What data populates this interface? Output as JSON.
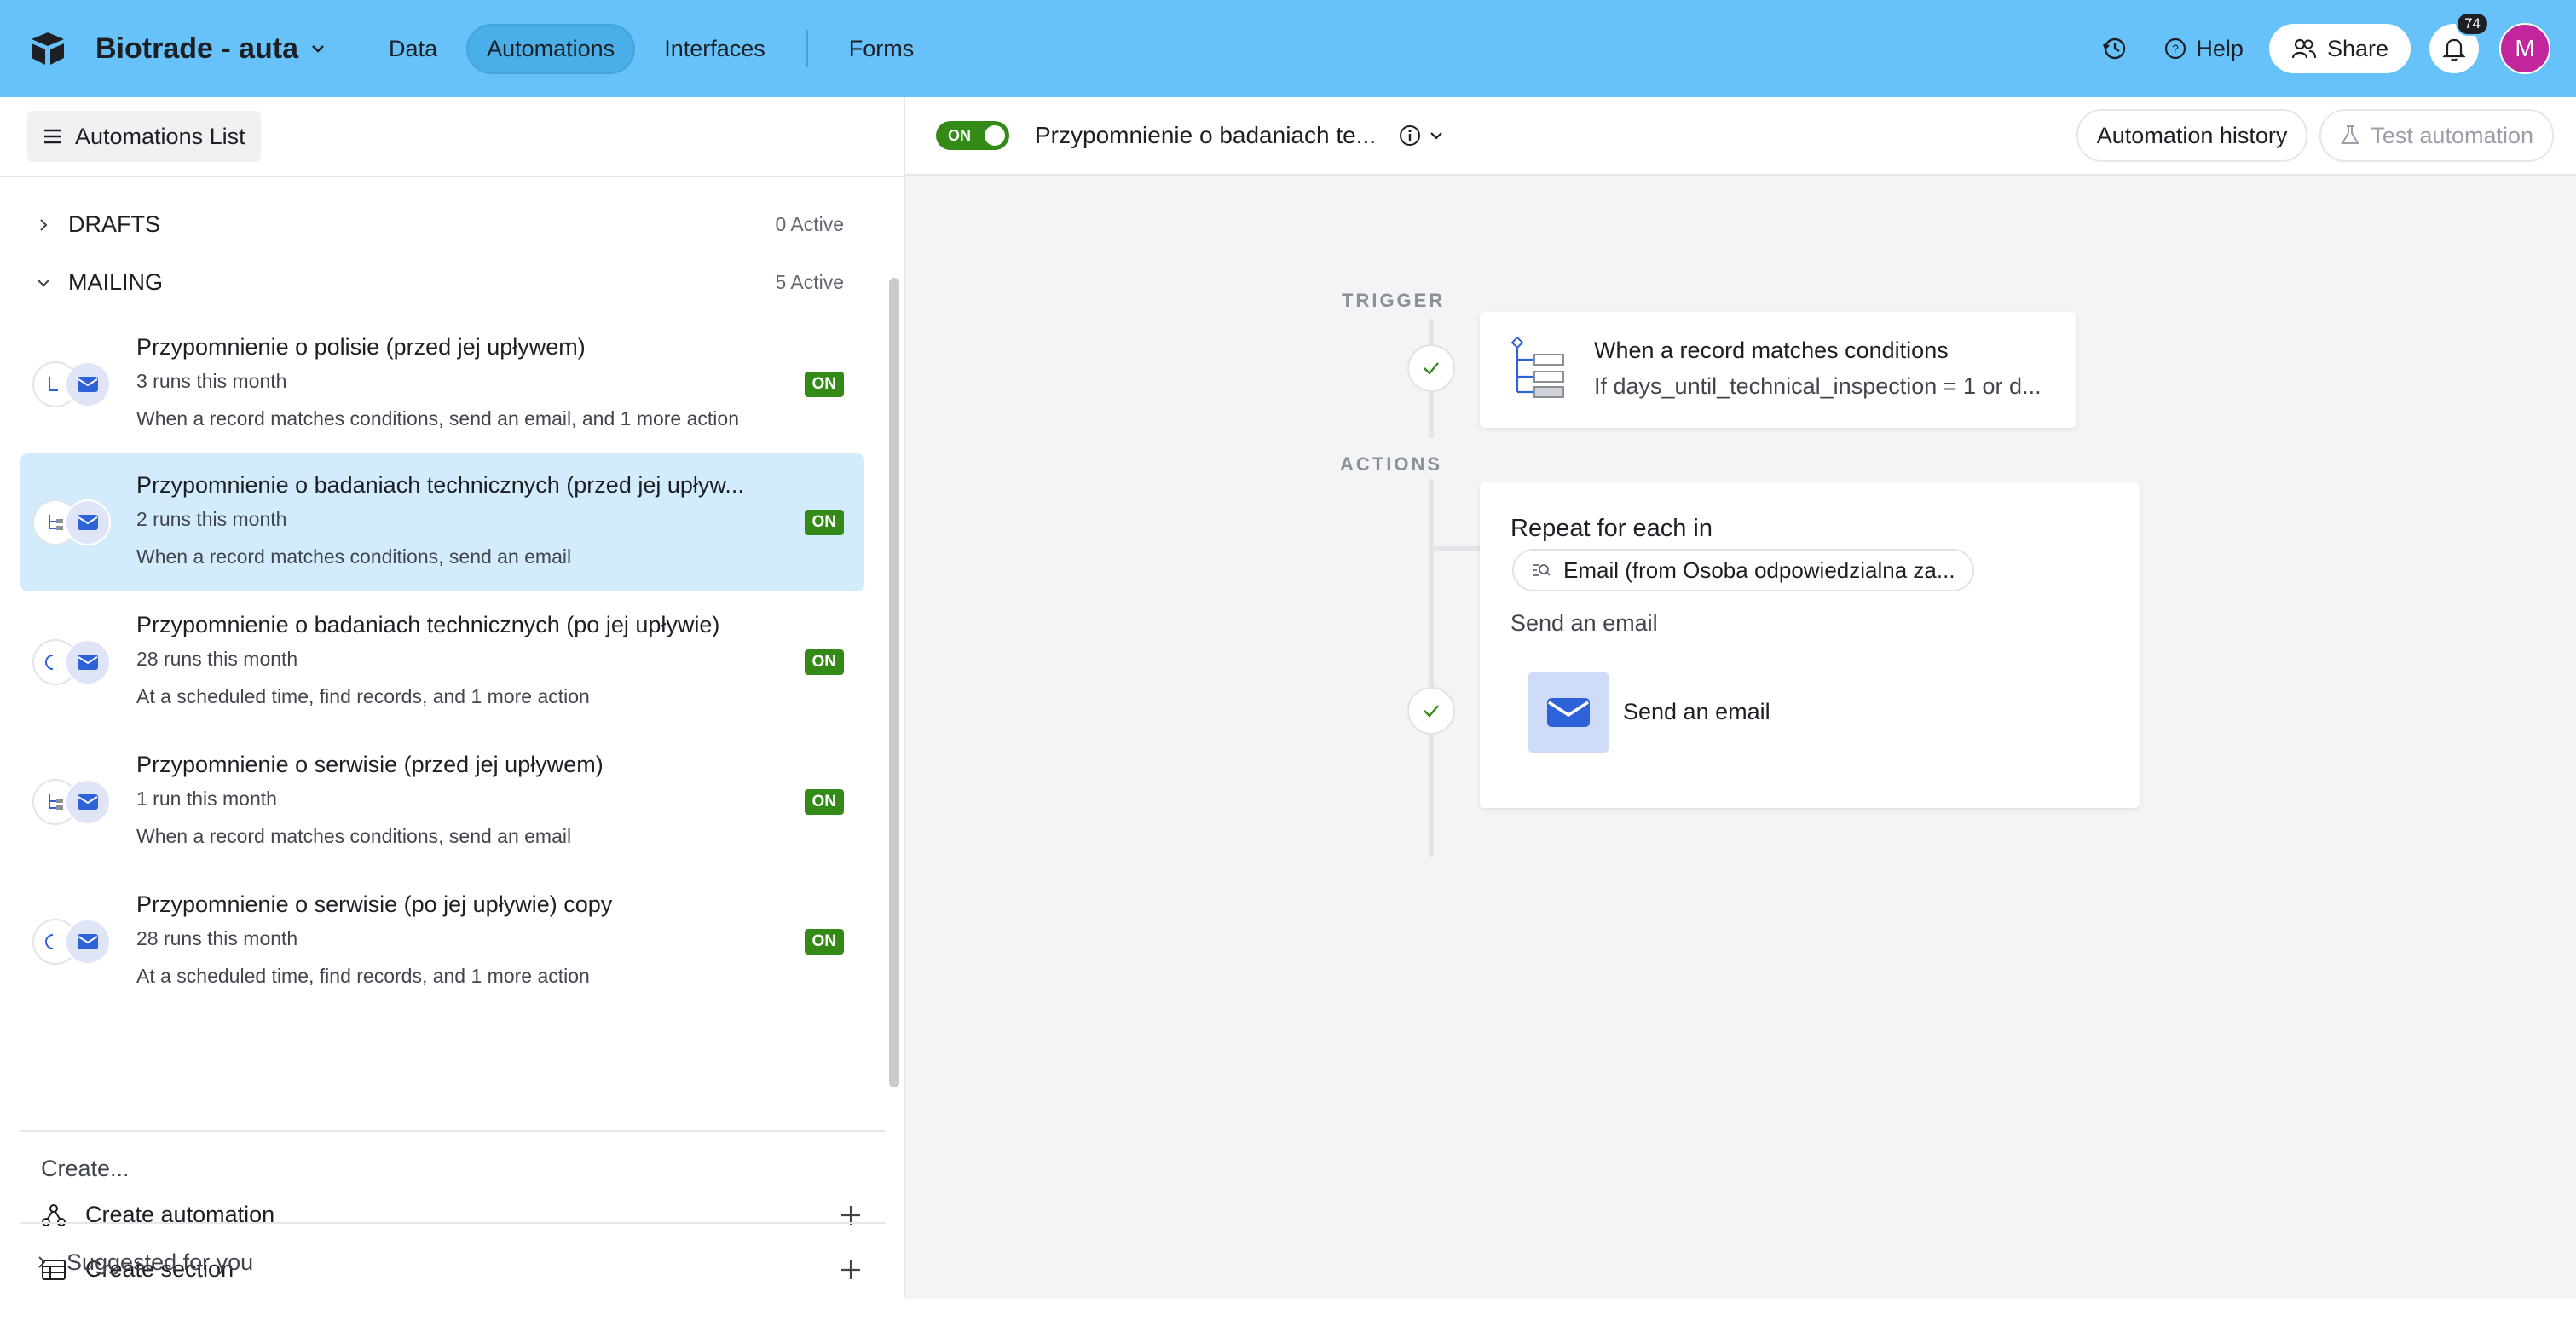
{
  "topbar": {
    "base_name": "Biotrade - auta",
    "tabs": [
      "Data",
      "Automations",
      "Interfaces"
    ],
    "forms_tab": "Forms",
    "help": "Help",
    "share": "Share",
    "notification_count": "74",
    "avatar_initial": "M",
    "bg_color": "#66c2f8"
  },
  "sidebar": {
    "list_button": "Automations List",
    "sections": [
      {
        "name": "DRAFTS",
        "count": "0 Active"
      },
      {
        "name": "MAILING",
        "count": "5 Active"
      }
    ],
    "automations": [
      {
        "title": "Przypomnienie o polisie (przed jej upływem)",
        "runs": "3 runs this month",
        "desc": "When a record matches conditions, send an email, and 1 more action",
        "status": "ON"
      },
      {
        "title": "Przypomnienie o badaniach technicznych (przed jej upływ...",
        "runs": "2 runs this month",
        "desc": "When a record matches conditions, send an email",
        "status": "ON"
      },
      {
        "title": "Przypomnienie o badaniach technicznych (po jej upływie)",
        "runs": "28 runs this month",
        "desc": "At a scheduled time, find records, and 1 more action",
        "status": "ON"
      },
      {
        "title": "Przypomnienie o serwisie (przed jej upływem)",
        "runs": "1 run this month",
        "desc": "When a record matches conditions, send an email",
        "status": "ON"
      },
      {
        "title": "Przypomnienie o serwisie (po jej upływie) copy",
        "runs": "28 runs this month",
        "desc": "At a scheduled time, find records, and 1 more action",
        "status": "ON"
      }
    ],
    "create_label": "Create...",
    "create_automation": "Create automation",
    "create_section": "Create section",
    "suggested": "Suggested for you",
    "on_color": "#338a17"
  },
  "main": {
    "toggle_label": "ON",
    "automation_name": "Przypomnienie o badaniach te...",
    "history_button": "Automation history",
    "test_button": "Test automation",
    "trigger_label": "TRIGGER",
    "actions_label": "ACTIONS",
    "trigger_title": "When a record matches conditions",
    "trigger_sub": "If days_until_technical_inspection = 1 or d...",
    "repeat_title": "Repeat for each in",
    "repeat_field": "Email (from Osoba odpowiedzialna za...",
    "send_label": "Send an email",
    "send_action": "Send an email"
  }
}
